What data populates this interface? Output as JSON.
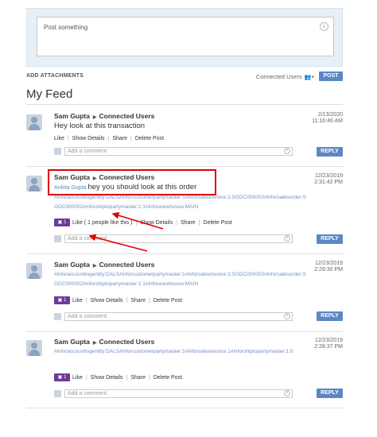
{
  "compose": {
    "placeholder": "Post something"
  },
  "toolbar": {
    "add_attachments": "ADD ATTACHMENTS",
    "connected_users": "Connected Users",
    "post_label": "POST"
  },
  "feed_title": "My Feed",
  "reply_label": "REPLY",
  "comment_placeholder": "Add a comment",
  "posts": [
    {
      "author": "Sam Gupta",
      "audience": "Connected Users",
      "date": "2/13/2020",
      "time": "11:16:46 AM",
      "mention": "",
      "message": "Hey look at this transaction",
      "tags": "",
      "like_count": "",
      "like_label": "Like",
      "show_details": "Show Details",
      "share": "Share",
      "delete": "Delete Post"
    },
    {
      "author": "Sam Gupta",
      "audience": "Connected Users",
      "date": "12/23/2019",
      "time": "2:31:42 PM",
      "mention": "Ankita Gupta",
      "message": "hey you should look at this order",
      "tags": "#inforaccountingentity:DALS#inforcustomerpartymaster:1#inforsalesinvoice:1:SGDC000002#inforsalesorder:SGDC000002#inforshiptopartymaster:1:1#inforwarehouse:MAIN",
      "like_count": "1",
      "like_label": "Like ( 1 people like this )",
      "show_details": "Show Details",
      "share": "Share",
      "delete": "Delete Post"
    },
    {
      "author": "Sam Gupta",
      "audience": "Connected Users",
      "date": "12/23/2019",
      "time": "2:29:30 PM",
      "mention": "",
      "message": "",
      "tags": "#inforaccountingentity:DALS#inforcustomerpartymaster:1#inforsalesinvoice:1:SGDC000002#inforsalesorder:SGDC000002#inforshiptopartymaster:1:1#inforwarehouse:MAIN",
      "like_count": "1",
      "like_label": "Like",
      "show_details": "Show Details",
      "share": "Share",
      "delete": "Delete Post"
    },
    {
      "author": "Sam Gupta",
      "audience": "Connected Users",
      "date": "12/23/2019",
      "time": "2:28:37 PM",
      "mention": "",
      "message": "",
      "tags": "#inforaccountingentity:DALS#inforcustomerpartymaster:1#inforsalesinvoice:1#inforshiptopartymaster:1:0",
      "like_count": "1",
      "like_label": "Like",
      "show_details": "Show Details",
      "share": "Share",
      "delete": "Delete Post"
    }
  ],
  "colors": {
    "accent": "#5b87c5",
    "like_badge": "#6d3a9c",
    "annotation": "#e00000",
    "tag_link": "#6f91c8"
  }
}
